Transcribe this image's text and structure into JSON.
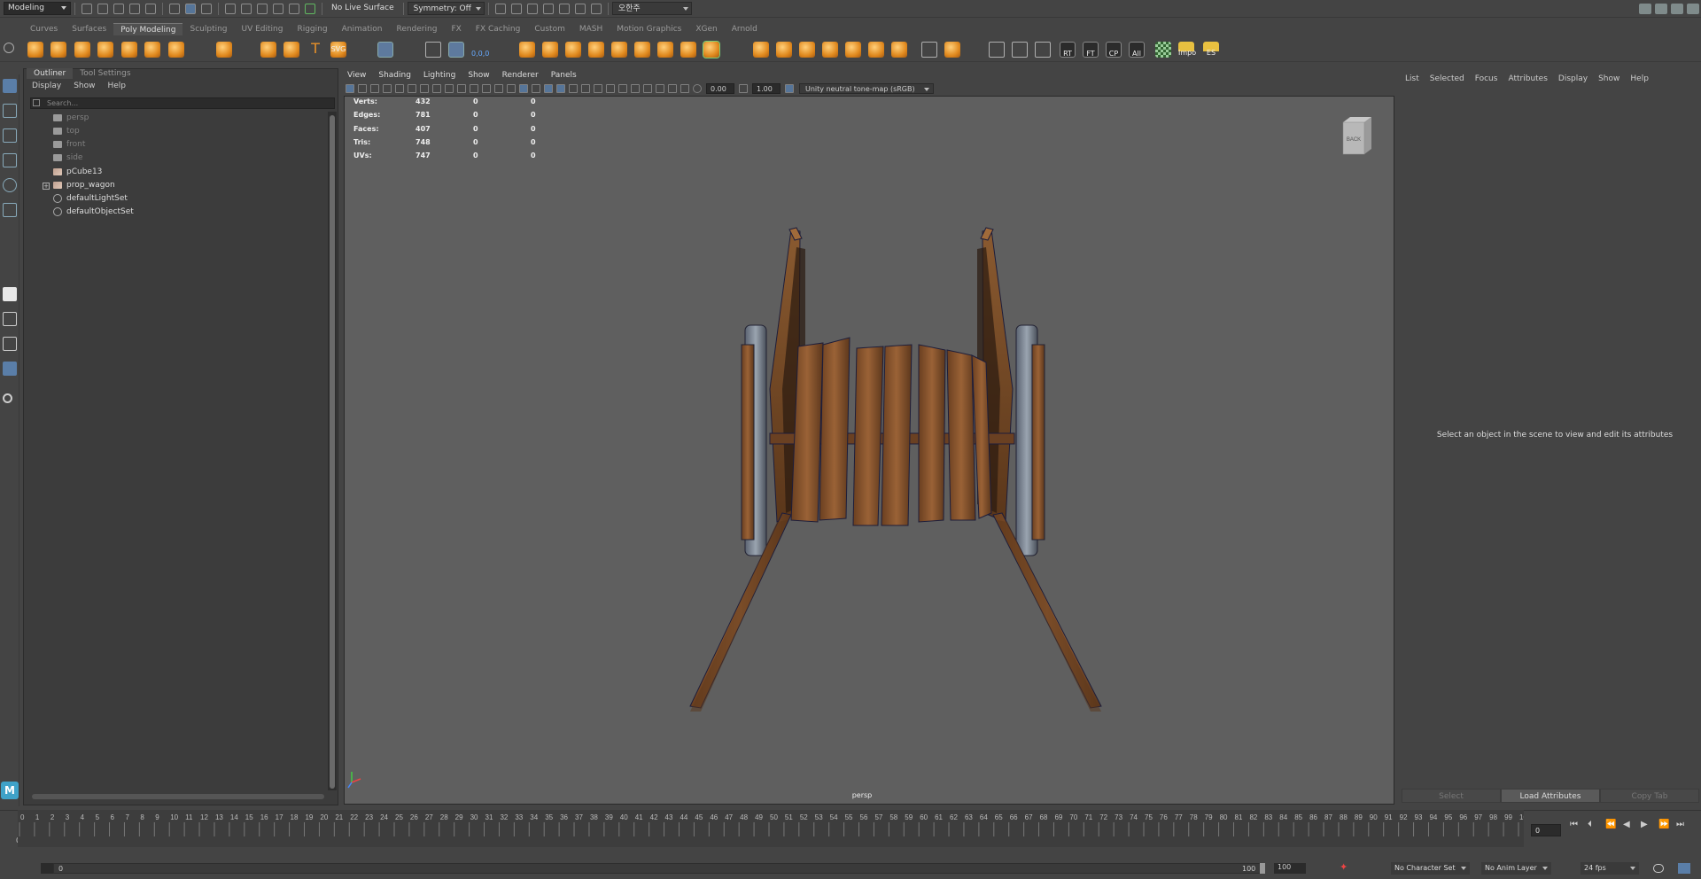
{
  "statusline": {
    "mode": "Modeling",
    "live_surface": "No Live Surface",
    "symmetry": "Symmetry: Off",
    "user": "오한주"
  },
  "shelf_tabs": [
    "Curves",
    "Surfaces",
    "Poly Modeling",
    "Sculpting",
    "UV Editing",
    "Rigging",
    "Animation",
    "Rendering",
    "FX",
    "FX Caching",
    "Custom",
    "MASH",
    "Motion Graphics",
    "XGen",
    "Arnold"
  ],
  "shelf_active_tab": "Poly Modeling",
  "shelf_labels": {
    "svg": "SVG",
    "coord": "0,0,0",
    "rt": "RT",
    "ft": "FT",
    "cp": "CP",
    "all": "All",
    "impo": "Impo",
    "es": "ES"
  },
  "outliner": {
    "tabs": [
      "Outliner",
      "Tool Settings"
    ],
    "menu": [
      "Display",
      "Show",
      "Help"
    ],
    "search_placeholder": "Search...",
    "items": [
      {
        "name": "persp",
        "dim": true,
        "icon": "camera-icon"
      },
      {
        "name": "top",
        "dim": true,
        "icon": "camera-icon"
      },
      {
        "name": "front",
        "dim": true,
        "icon": "camera-icon"
      },
      {
        "name": "side",
        "dim": true,
        "icon": "camera-icon"
      },
      {
        "name": "pCube13",
        "dim": false,
        "icon": "mesh-icon"
      },
      {
        "name": "prop_wagon",
        "dim": false,
        "icon": "mesh-icon",
        "expandable": true
      },
      {
        "name": "defaultLightSet",
        "dim": false,
        "icon": "set-icon"
      },
      {
        "name": "defaultObjectSet",
        "dim": false,
        "icon": "set-icon"
      }
    ]
  },
  "viewport": {
    "menu": [
      "View",
      "Shading",
      "Lighting",
      "Show",
      "Renderer",
      "Panels"
    ],
    "exposure": "0.00",
    "gamma": "1.00",
    "colorspace": "Unity neutral tone-map (sRGB)",
    "camera": "persp",
    "viewcube": "BACK",
    "hud": [
      {
        "label": "Verts:",
        "v1": "432",
        "v2": "0",
        "v3": "0"
      },
      {
        "label": "Edges:",
        "v1": "781",
        "v2": "0",
        "v3": "0"
      },
      {
        "label": "Faces:",
        "v1": "407",
        "v2": "0",
        "v3": "0"
      },
      {
        "label": "Tris:",
        "v1": "748",
        "v2": "0",
        "v3": "0"
      },
      {
        "label": "UVs:",
        "v1": "747",
        "v2": "0",
        "v3": "0"
      }
    ]
  },
  "attribute_editor": {
    "menu": [
      "List",
      "Selected",
      "Focus",
      "Attributes",
      "Display",
      "Show",
      "Help"
    ],
    "message": "Select an object in the scene to view and edit its attributes",
    "buttons": [
      "Select",
      "Load Attributes",
      "Copy Tab"
    ]
  },
  "timeline": {
    "start": 0,
    "end": 100,
    "current_frame": "0",
    "side_value": "0"
  },
  "range": {
    "start": "0",
    "inner_start": "0",
    "inner_end": "100",
    "end": "100",
    "character_set": "No Character Set",
    "anim_layer": "No Anim Layer",
    "fps": "24 fps"
  },
  "colors": {
    "accent_orange": "#e8912a",
    "viewport_bg": "#5f5f5f",
    "wood": "#8a5a30",
    "maya_logo": "#3fa2c8"
  }
}
